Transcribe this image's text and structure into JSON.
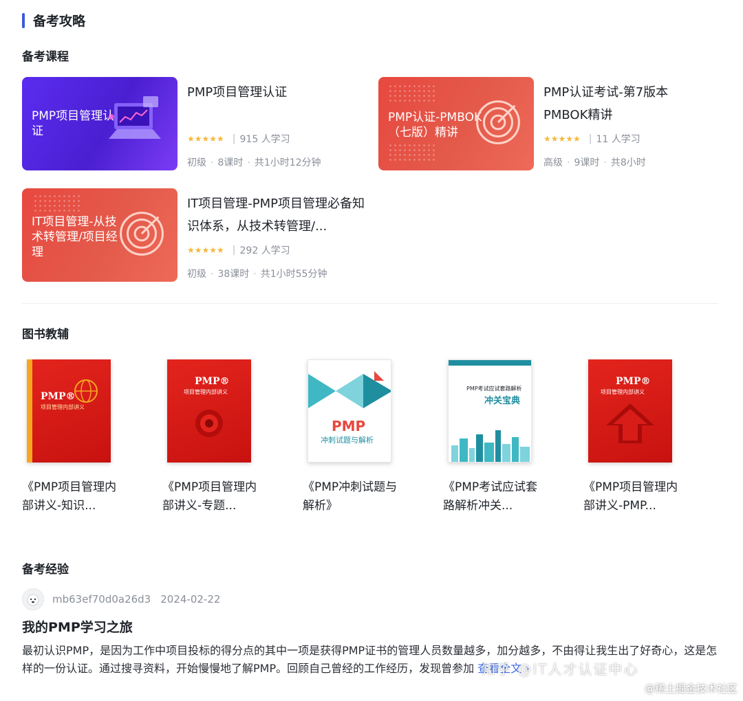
{
  "header": {
    "title": "备考攻略",
    "accent_color": "#3b5bdb"
  },
  "courses_section": {
    "title": "备考课程",
    "courses": [
      {
        "thumb_text": "PMP项目管理认证",
        "title": "PMP项目管理认证",
        "stars": "★★★★★",
        "learners": "915 人学习",
        "level": "初级",
        "lessons": "8课时",
        "duration": "共1小时12分钟"
      },
      {
        "thumb_text": "PMP认证-PMBOK（七版）精讲",
        "title": "PMP认证考试-第7版本PMBOK精讲",
        "stars": "★★★★★",
        "learners": "11 人学习",
        "level": "高级",
        "lessons": "9课时",
        "duration": "共8小时"
      },
      {
        "thumb_text": "IT项目管理-从技术转管理/项目经理",
        "title": "IT项目管理-PMP项目管理必备知识体系，从技术转管理/...",
        "stars": "★★★★★",
        "learners": "292 人学习",
        "level": "初级",
        "lessons": "38课时",
        "duration": "共1小时55分钟"
      }
    ]
  },
  "books_section": {
    "title": "图书教辅",
    "books": [
      {
        "title": "《PMP项目管理内部讲义-知识...",
        "cover_label": "PMP®",
        "cover_sub": "项目管理内部讲义"
      },
      {
        "title": "《PMP项目管理内部讲义-专题...",
        "cover_label": "PMP®",
        "cover_sub": "项目管理内部讲义"
      },
      {
        "title": "《PMP冲刺试题与解析》",
        "cover_label": "PMP",
        "cover_sub": "冲刺试题与解析"
      },
      {
        "title": "《PMP考试应试套路解析冲关...",
        "cover_label": "PMP考试应试套路解析",
        "cover_sub": "冲关宝典"
      },
      {
        "title": "《PMP项目管理内部讲义-PMP...",
        "cover_label": "PMP®",
        "cover_sub": "项目管理内部讲义"
      }
    ]
  },
  "experience_section": {
    "title": "备考经验",
    "author": "mb63ef70d0a26d3",
    "date": "2024-02-22",
    "post_title": "我的PMP学习之旅",
    "post_body": "最初认识PMP，是因为工作中项目投标的得分点的其中一项是获得PMP证书的管理人员数量越多，加分越多，不由得让我生出了好奇心，这是怎样的一份认证。通过搜寻资料，开始慢慢地了解PMP。回顾自己曾经的工作经历，发现曾参加",
    "read_more": "查看全文 ›"
  },
  "watermarks": {
    "zhihu": "知乎 @IT人才认证中心",
    "juejin": "@稀土掘金技术社区"
  }
}
